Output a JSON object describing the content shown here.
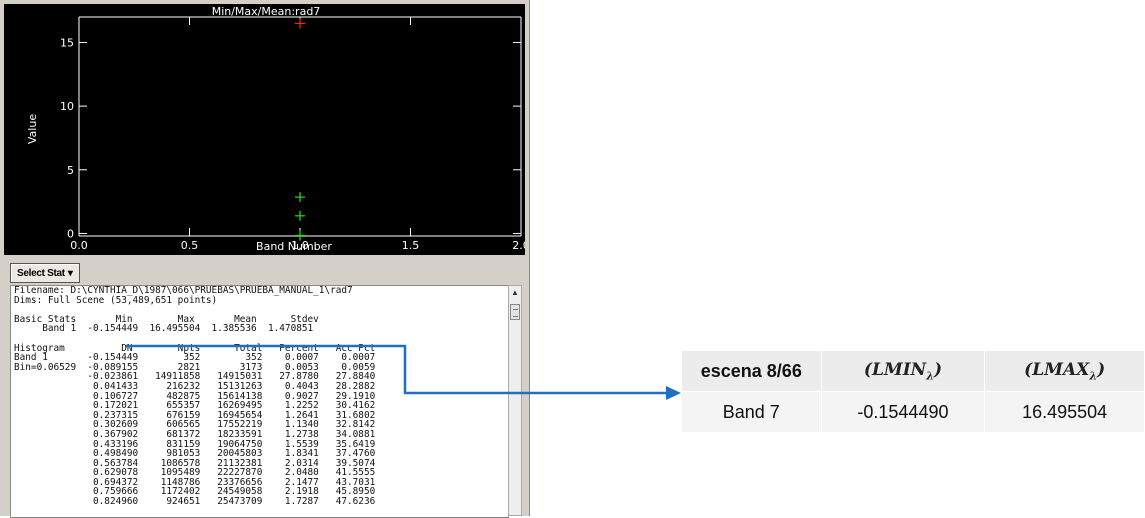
{
  "window": {
    "plot": {
      "title": "Min/Max/Mean:rad7",
      "xlabel": "Band Number",
      "ylabel": "Value",
      "x_ticks": [
        "0.0",
        "0.5",
        "1.0",
        "1.5",
        "2.0"
      ],
      "y_ticks": [
        "0",
        "5",
        "10",
        "15"
      ],
      "colors": {
        "max": "#ff2020",
        "mean": "#20e020",
        "background": "#000000",
        "axes": "#ffffff"
      }
    },
    "select_stat_label": "Select Stat",
    "report_lines": [
      "Filename: D:\\CYNTHIA_D\\1987\\066\\PRUEBAS\\PRUEBA_MANUAL_1\\rad7",
      "Dims: Full Scene (53,489,651 points)",
      "",
      "Basic Stats       Min        Max       Mean      Stdev",
      "     Band 1  -0.154449  16.495504  1.385536  1.470851",
      "",
      "Histogram          DN        Npts      Total   Percent   Acc Pct",
      "Band 1       -0.154449        352        352    0.0007    0.0007",
      "Bin=0.06529  -0.089155       2821       3173    0.0053    0.0059",
      "             -0.023861   14911858   14915031   27.8780   27.8840",
      "              0.041433     216232   15131263    0.4043   28.2882",
      "              0.106727     482875   15614138    0.9027   29.1910",
      "              0.172021     655357   16269495    1.2252   30.4162",
      "              0.237315     676159   16945654    1.2641   31.6802",
      "              0.302609     606565   17552219    1.1340   32.8142",
      "              0.367902     681372   18233591    1.2738   34.0881",
      "              0.433196     831159   19064750    1.5539   35.6419",
      "              0.498490     981053   20045803    1.8341   37.4760",
      "              0.563784    1086578   21132381    2.0314   39.5074",
      "              0.629078    1095489   22227870    2.0480   41.5555",
      "              0.694372    1148786   23376656    2.1477   43.7031",
      "              0.759666    1172402   24549058    2.1918   45.8950",
      "              0.824960     924651   25473709    1.7287   47.6236"
    ]
  },
  "chart_data": {
    "type": "scatter",
    "title": "Min/Max/Mean:rad7",
    "xlabel": "Band Number",
    "ylabel": "Value",
    "xlim": [
      0,
      2
    ],
    "ylim": [
      -0.2,
      17
    ],
    "grid": false,
    "series": [
      {
        "color": "#20e020",
        "points": [
          [
            1.0,
            -0.154449
          ]
        ]
      },
      {
        "color": "#ff2020",
        "points": [
          [
            1.0,
            16.495504
          ]
        ]
      },
      {
        "color": "#20e020",
        "points": [
          [
            1.0,
            1.385536
          ]
        ]
      },
      {
        "color": "#20e020",
        "points": [
          [
            1.0,
            2.856387
          ]
        ]
      }
    ]
  },
  "summary_table": {
    "header": {
      "label": "escena 8/66",
      "lmin": "LMIN",
      "lmax": "LMAX",
      "subscript": "λ"
    },
    "rows": [
      {
        "band": "Band 7",
        "lmin": "-0.1544490",
        "lmax": "16.495504"
      }
    ]
  },
  "colors": {
    "connector": "#1f70c1"
  }
}
